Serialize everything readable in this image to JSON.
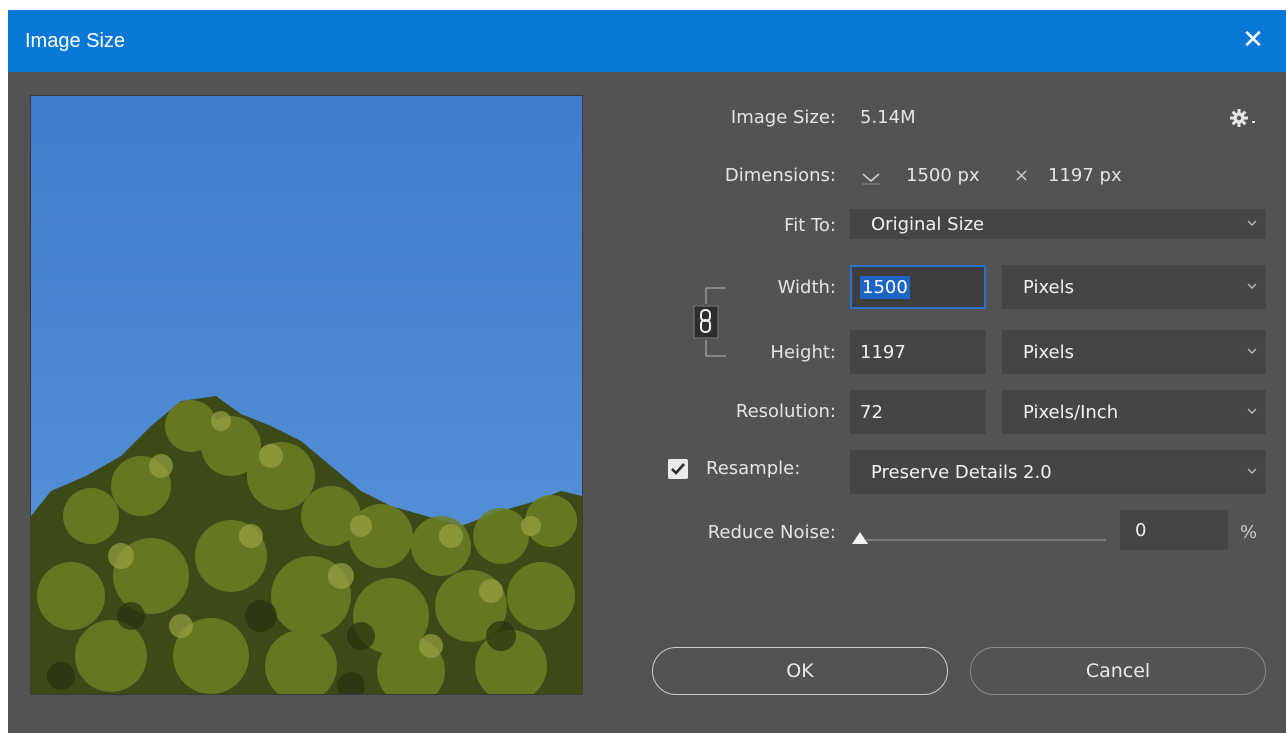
{
  "titlebar": {
    "title": "Image Size",
    "close_glyph": "✕"
  },
  "preview": {
    "alt": "Pine trees against a blue sky"
  },
  "settings": {
    "icon": "gear-icon"
  },
  "image_size": {
    "label": "Image Size:",
    "value": "5.14M"
  },
  "dimensions": {
    "label": "Dimensions:",
    "width": "1500 px",
    "times": "×",
    "height": "1197 px"
  },
  "fit_to": {
    "label": "Fit To:",
    "value": "Original Size"
  },
  "width": {
    "label": "Width:",
    "value": "1500",
    "unit": "Pixels"
  },
  "height": {
    "label": "Height:",
    "value": "1197",
    "unit": "Pixels"
  },
  "resolution": {
    "label": "Resolution:",
    "value": "72",
    "unit": "Pixels/Inch"
  },
  "resample": {
    "label": "Resample:",
    "checked": true,
    "method": "Preserve Details 2.0"
  },
  "reduce_noise": {
    "label": "Reduce Noise:",
    "value": "0",
    "unit": "%",
    "level": 0
  },
  "buttons": {
    "ok": "OK",
    "cancel": "Cancel"
  },
  "colors": {
    "titlebar": "#0a78d7",
    "dialog_bg": "#535353",
    "field_bg": "#454545",
    "focus": "#2a72cf"
  }
}
